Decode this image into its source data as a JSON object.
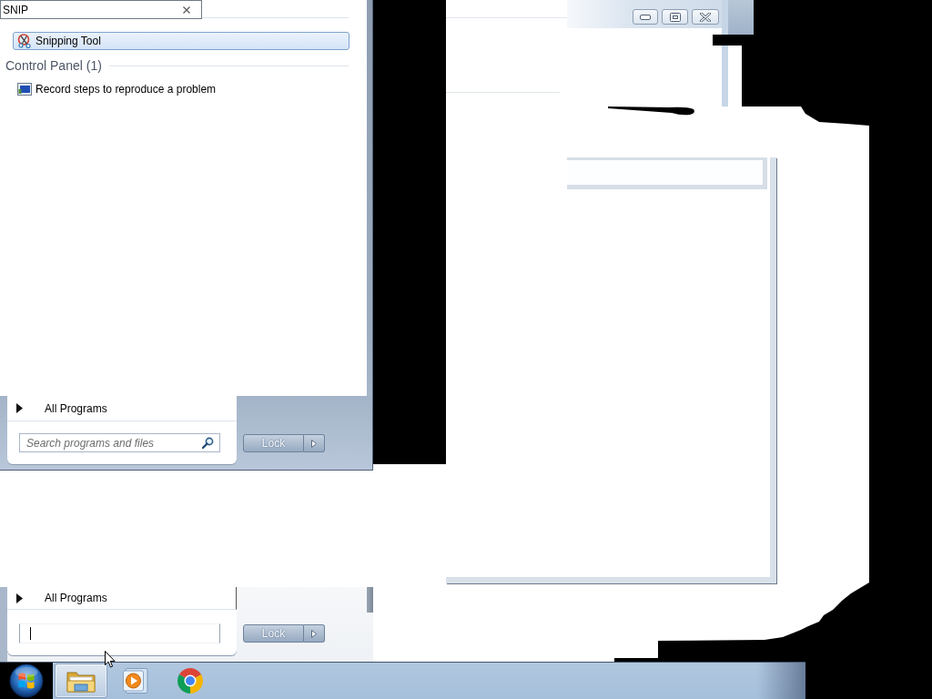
{
  "start_menu": {
    "search_box": {
      "value": "SNIP"
    },
    "results": [
      {
        "kind": "program",
        "label": "Snipping Tool",
        "selected": true
      },
      {
        "kind": "heading",
        "label": "Control Panel (1)"
      },
      {
        "kind": "control_panel",
        "label": "Record steps to reproduce a problem",
        "selected": false
      }
    ],
    "all_programs": "All Programs",
    "search_field": {
      "placeholder": "Search programs and files"
    },
    "power_button": {
      "label": "Lock"
    }
  },
  "start_menu_ghost": {
    "all_programs": "All Programs",
    "search_field": {
      "focused": true
    },
    "power_button": {
      "label": "Lock"
    }
  },
  "window": {
    "buttons": [
      {
        "kind": "minimize"
      },
      {
        "kind": "maximize"
      },
      {
        "kind": "close"
      }
    ]
  },
  "taskbar": {
    "items": [
      {
        "kind": "folder",
        "active": true
      },
      {
        "kind": "player",
        "active": false
      },
      {
        "kind": "browser",
        "active": false
      }
    ]
  }
}
